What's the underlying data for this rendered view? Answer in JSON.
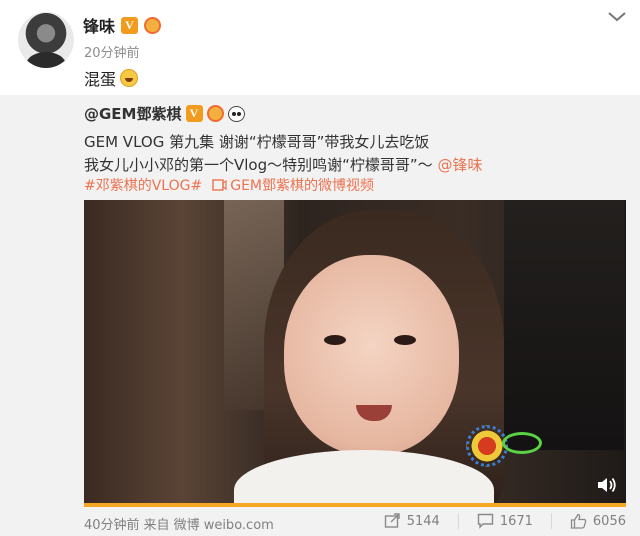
{
  "post": {
    "author": "锋味",
    "time": "20分钟前",
    "text": "混蛋"
  },
  "repost": {
    "author": "@GEM鄧紫棋",
    "line1": "GEM VLOG 第九集 谢谢“柠檬哥哥”带我女儿去吃饭",
    "line2_text": "我女儿小小邓的第一个Vlog～特别鸣谢“柠檬哥哥”～ ",
    "line2_mention": "@锋味",
    "hashtag": "#邓紫棋的VLOG#",
    "video_link": "GEM鄧紫棋的微博视频",
    "source_time": "40分钟前",
    "source_from": "来自",
    "source_app": "微博 weibo.com",
    "reposts": "5144",
    "comments": "1671",
    "likes": "6056"
  },
  "icons": {
    "menu": "chevron-down-icon",
    "vip": "verified-v-badge-icon",
    "emoji": "laugh-emoji-icon",
    "panda": "panda-icon",
    "video": "video-icon",
    "speaker": "speaker-icon",
    "repost": "repost-icon",
    "comment": "comment-icon",
    "like": "thumbs-up-icon"
  },
  "colors": {
    "accent": "#eb7350",
    "vip_badge": "#f29c1f",
    "progress": "#f5a623",
    "card_bg": "#f2f2f2"
  }
}
